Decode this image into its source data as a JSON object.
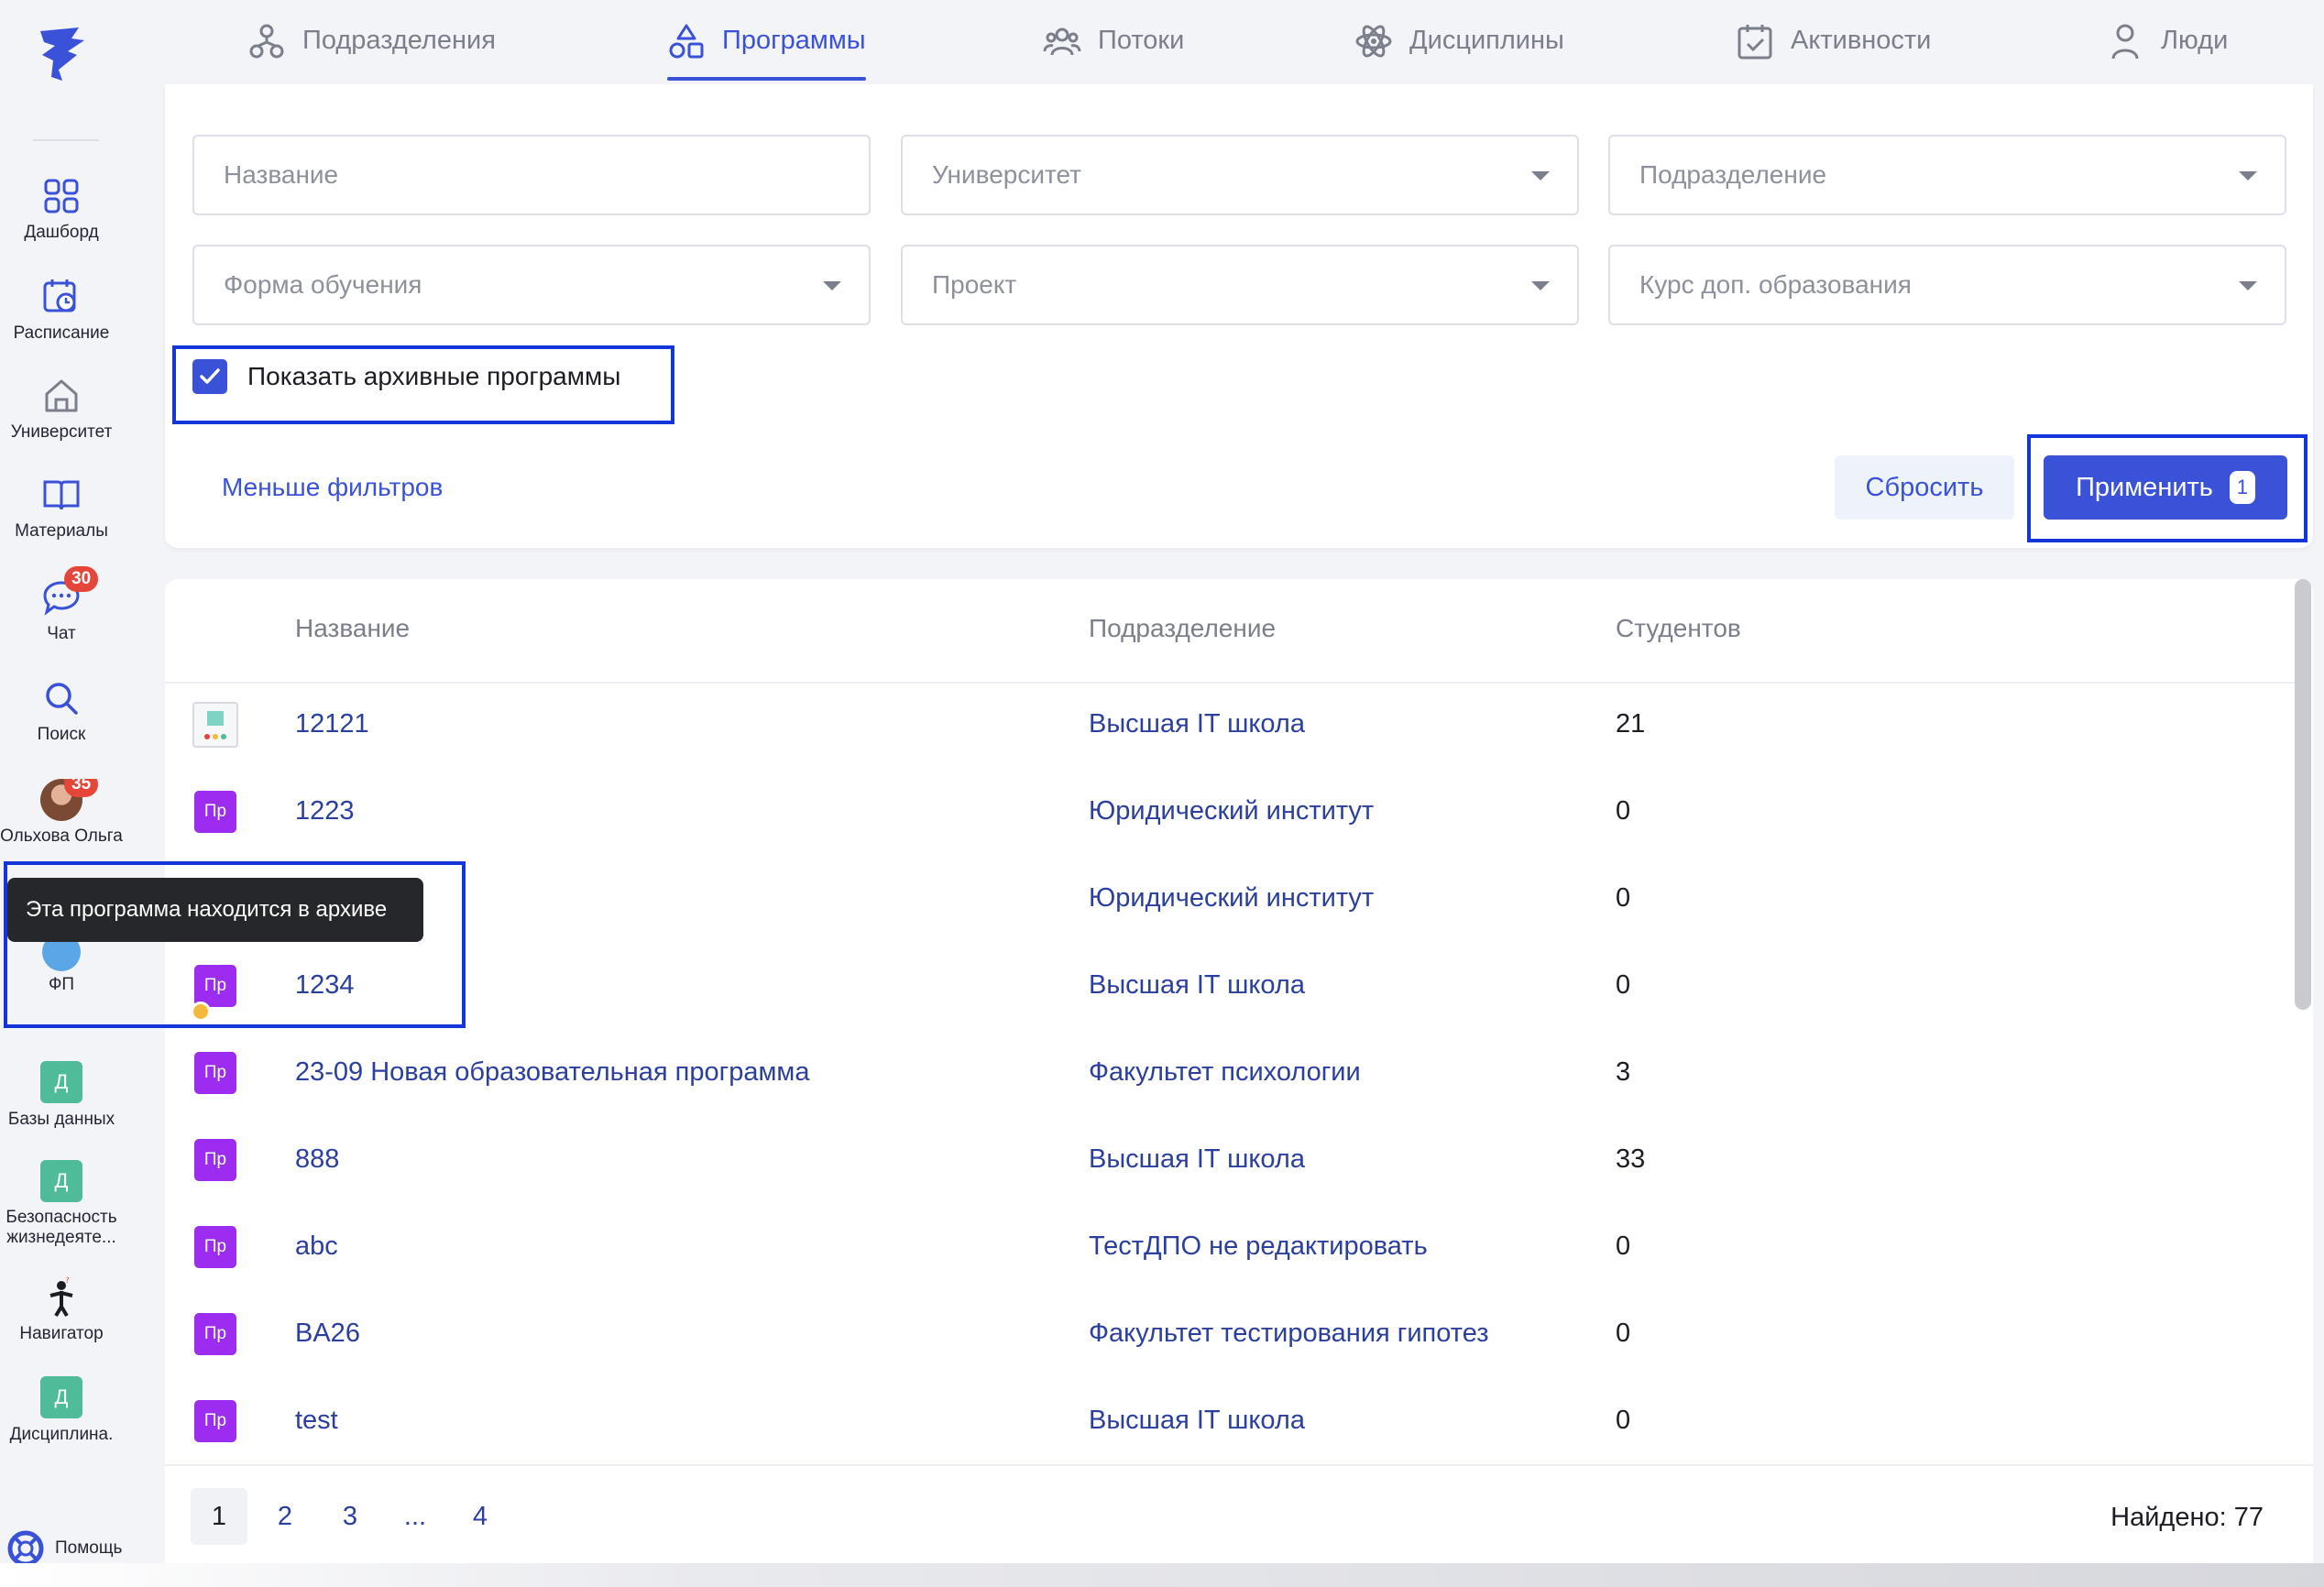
{
  "sidebar": {
    "items": [
      {
        "label": "Дашборд",
        "icon": "grid-icon"
      },
      {
        "label": "Расписание",
        "icon": "calendar-clock-icon"
      },
      {
        "label": "Университет",
        "icon": "home-icon"
      },
      {
        "label": "Материалы",
        "icon": "book-icon"
      },
      {
        "label": "Чат",
        "icon": "chat-icon",
        "badge": "30"
      },
      {
        "label": "Поиск",
        "icon": "search-icon"
      },
      {
        "label": "Ольхова Ольга",
        "icon": "avatar",
        "badge": "35"
      },
      {
        "label": "ФП",
        "icon": "fp-icon"
      },
      {
        "label": "Базы данных",
        "icon": "letter-d-icon",
        "letter": "Д"
      },
      {
        "label": "Безопасность жизнедеяте...",
        "icon": "letter-d-icon",
        "letter": "Д"
      },
      {
        "label": "Навигатор",
        "icon": "navigator-figure-icon"
      },
      {
        "label": "Дисциплина.",
        "icon": "letter-d-icon",
        "letter": "Д"
      }
    ],
    "help_label": "Помощь"
  },
  "tabs": [
    {
      "label": "Подразделения",
      "icon": "units-icon",
      "active": false
    },
    {
      "label": "Программы",
      "icon": "shapes-icon",
      "active": true
    },
    {
      "label": "Потоки",
      "icon": "people-group-icon",
      "active": false
    },
    {
      "label": "Дисциплины",
      "icon": "atom-icon",
      "active": false
    },
    {
      "label": "Активности",
      "icon": "calendar-check-icon",
      "active": false
    },
    {
      "label": "Люди",
      "icon": "person-icon",
      "active": false
    }
  ],
  "filters": {
    "name_placeholder": "Название",
    "university_placeholder": "Университет",
    "unit_placeholder": "Подразделение",
    "study_form_placeholder": "Форма обучения",
    "project_placeholder": "Проект",
    "course_placeholder": "Курс доп. образования",
    "show_archived_label": "Показать архивные программы",
    "show_archived_checked": true,
    "fewer_filters_label": "Меньше фильтров",
    "reset_label": "Сбросить",
    "apply_label": "Применить",
    "apply_count": "1"
  },
  "table": {
    "headers": {
      "name": "Название",
      "unit": "Подразделение",
      "students": "Студентов"
    },
    "rows": [
      {
        "icon": "image-thumb",
        "tag": "",
        "name": "12121",
        "unit": "Высшая IT школа",
        "students": "21"
      },
      {
        "icon": "tag",
        "tag": "Пр",
        "name": "1223",
        "unit": "Юридический институт",
        "students": "0"
      },
      {
        "icon": "tag",
        "tag": "Пр",
        "name": "",
        "unit": "Юридический институт",
        "students": "0"
      },
      {
        "icon": "tag",
        "tag": "Пр",
        "name": "1234",
        "unit": "Высшая IT школа",
        "students": "0",
        "archived": true
      },
      {
        "icon": "tag",
        "tag": "Пр",
        "name": "23-09 Новая образовательная программа",
        "unit": "Факультет психологии",
        "students": "3"
      },
      {
        "icon": "tag",
        "tag": "Пр",
        "name": "888",
        "unit": "Высшая IT школа",
        "students": "33"
      },
      {
        "icon": "tag",
        "tag": "Пр",
        "name": "abc",
        "unit": "ТестДПО не редактировать",
        "students": "0"
      },
      {
        "icon": "tag",
        "tag": "Пр",
        "name": "BA26",
        "unit": "Факультет тестирования гипотез",
        "students": "0"
      },
      {
        "icon": "tag",
        "tag": "Пр",
        "name": "test",
        "unit": "Высшая IT школа",
        "students": "0"
      }
    ]
  },
  "pagination": {
    "pages": [
      "1",
      "2",
      "3",
      "...",
      "4"
    ],
    "current": "1",
    "found_label": "Найдено: 77"
  },
  "tooltip": {
    "text": "Эта программа находится в архиве"
  },
  "colors": {
    "accent": "#3a52d8",
    "tag": "#9b2cf0",
    "highlight": "#1436d8",
    "badge": "#e5463a"
  }
}
